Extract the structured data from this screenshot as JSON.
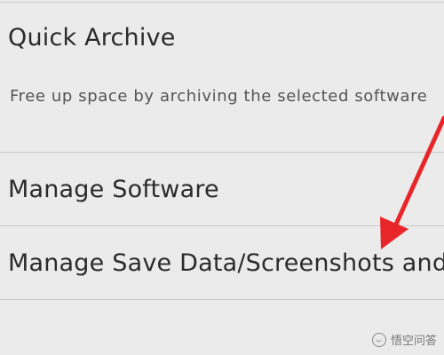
{
  "menu": {
    "items": [
      {
        "label": "Quick Archive",
        "description": "Free up space by archiving the selected software"
      },
      {
        "label": "Manage Software"
      },
      {
        "label": "Manage Save Data/Screenshots and Videos"
      }
    ]
  },
  "annotation": {
    "arrow_color": "#e8262a"
  },
  "watermark": {
    "text": "悟空问答"
  }
}
